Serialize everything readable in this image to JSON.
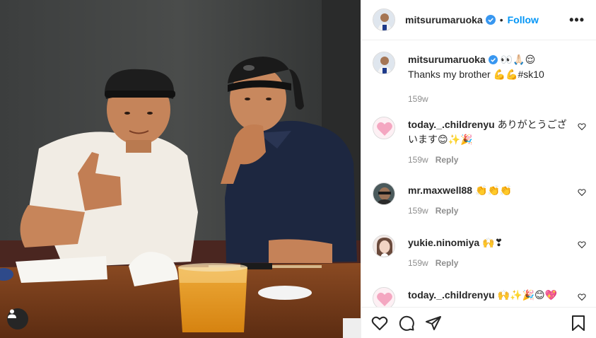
{
  "post": {
    "author": "mitsurumaruoka",
    "separator": "•",
    "follow_label": "Follow",
    "more_label": "•••"
  },
  "comments": [
    {
      "user": "mitsurumaruoka",
      "text": "👀🙏🏻😌",
      "text2": "Thanks my brother 💪💪#sk10",
      "time": "159w",
      "reply": ""
    },
    {
      "user": "today._.childrenyu",
      "text": "ありがとうございます😊✨🎉",
      "time": "159w",
      "reply": "Reply"
    },
    {
      "user": "mr.maxwell88",
      "text": "👏👏👏",
      "time": "159w",
      "reply": "Reply"
    },
    {
      "user": "yukie.ninomiya",
      "text": "🙌❣",
      "time": "159w",
      "reply": "Reply"
    },
    {
      "user": "today._.childrenyu",
      "text": "🙌✨🎉😊💖",
      "time": "",
      "reply": ""
    }
  ],
  "colors": {
    "link": "#0095f6",
    "text": "#262626",
    "muted": "#8e8e8e",
    "border": "#efefef"
  },
  "icons": [
    "verified-badge-icon",
    "more-options-icon",
    "heart-icon",
    "comment-icon",
    "share-icon",
    "bookmark-icon",
    "tagged-user-icon"
  ]
}
